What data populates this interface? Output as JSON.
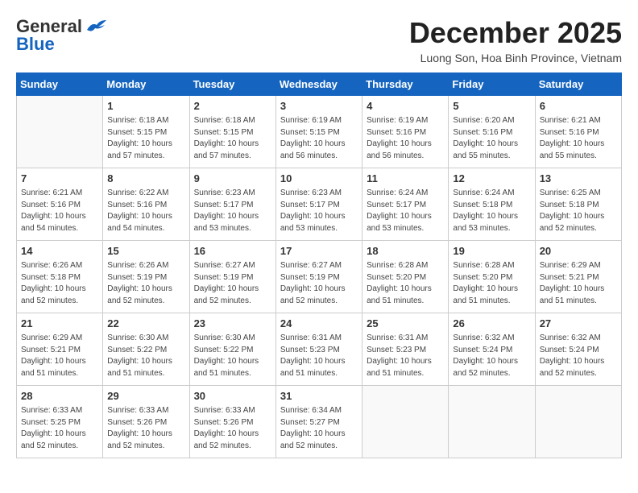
{
  "header": {
    "logo_line1": "General",
    "logo_line2": "Blue",
    "month_title": "December 2025",
    "subtitle": "Luong Son, Hoa Binh Province, Vietnam"
  },
  "weekdays": [
    "Sunday",
    "Monday",
    "Tuesday",
    "Wednesday",
    "Thursday",
    "Friday",
    "Saturday"
  ],
  "weeks": [
    [
      {
        "day": "",
        "info": ""
      },
      {
        "day": "1",
        "info": "Sunrise: 6:18 AM\nSunset: 5:15 PM\nDaylight: 10 hours\nand 57 minutes."
      },
      {
        "day": "2",
        "info": "Sunrise: 6:18 AM\nSunset: 5:15 PM\nDaylight: 10 hours\nand 57 minutes."
      },
      {
        "day": "3",
        "info": "Sunrise: 6:19 AM\nSunset: 5:15 PM\nDaylight: 10 hours\nand 56 minutes."
      },
      {
        "day": "4",
        "info": "Sunrise: 6:19 AM\nSunset: 5:16 PM\nDaylight: 10 hours\nand 56 minutes."
      },
      {
        "day": "5",
        "info": "Sunrise: 6:20 AM\nSunset: 5:16 PM\nDaylight: 10 hours\nand 55 minutes."
      },
      {
        "day": "6",
        "info": "Sunrise: 6:21 AM\nSunset: 5:16 PM\nDaylight: 10 hours\nand 55 minutes."
      }
    ],
    [
      {
        "day": "7",
        "info": "Sunrise: 6:21 AM\nSunset: 5:16 PM\nDaylight: 10 hours\nand 54 minutes."
      },
      {
        "day": "8",
        "info": "Sunrise: 6:22 AM\nSunset: 5:16 PM\nDaylight: 10 hours\nand 54 minutes."
      },
      {
        "day": "9",
        "info": "Sunrise: 6:23 AM\nSunset: 5:17 PM\nDaylight: 10 hours\nand 53 minutes."
      },
      {
        "day": "10",
        "info": "Sunrise: 6:23 AM\nSunset: 5:17 PM\nDaylight: 10 hours\nand 53 minutes."
      },
      {
        "day": "11",
        "info": "Sunrise: 6:24 AM\nSunset: 5:17 PM\nDaylight: 10 hours\nand 53 minutes."
      },
      {
        "day": "12",
        "info": "Sunrise: 6:24 AM\nSunset: 5:18 PM\nDaylight: 10 hours\nand 53 minutes."
      },
      {
        "day": "13",
        "info": "Sunrise: 6:25 AM\nSunset: 5:18 PM\nDaylight: 10 hours\nand 52 minutes."
      }
    ],
    [
      {
        "day": "14",
        "info": "Sunrise: 6:26 AM\nSunset: 5:18 PM\nDaylight: 10 hours\nand 52 minutes."
      },
      {
        "day": "15",
        "info": "Sunrise: 6:26 AM\nSunset: 5:19 PM\nDaylight: 10 hours\nand 52 minutes."
      },
      {
        "day": "16",
        "info": "Sunrise: 6:27 AM\nSunset: 5:19 PM\nDaylight: 10 hours\nand 52 minutes."
      },
      {
        "day": "17",
        "info": "Sunrise: 6:27 AM\nSunset: 5:19 PM\nDaylight: 10 hours\nand 52 minutes."
      },
      {
        "day": "18",
        "info": "Sunrise: 6:28 AM\nSunset: 5:20 PM\nDaylight: 10 hours\nand 51 minutes."
      },
      {
        "day": "19",
        "info": "Sunrise: 6:28 AM\nSunset: 5:20 PM\nDaylight: 10 hours\nand 51 minutes."
      },
      {
        "day": "20",
        "info": "Sunrise: 6:29 AM\nSunset: 5:21 PM\nDaylight: 10 hours\nand 51 minutes."
      }
    ],
    [
      {
        "day": "21",
        "info": "Sunrise: 6:29 AM\nSunset: 5:21 PM\nDaylight: 10 hours\nand 51 minutes."
      },
      {
        "day": "22",
        "info": "Sunrise: 6:30 AM\nSunset: 5:22 PM\nDaylight: 10 hours\nand 51 minutes."
      },
      {
        "day": "23",
        "info": "Sunrise: 6:30 AM\nSunset: 5:22 PM\nDaylight: 10 hours\nand 51 minutes."
      },
      {
        "day": "24",
        "info": "Sunrise: 6:31 AM\nSunset: 5:23 PM\nDaylight: 10 hours\nand 51 minutes."
      },
      {
        "day": "25",
        "info": "Sunrise: 6:31 AM\nSunset: 5:23 PM\nDaylight: 10 hours\nand 51 minutes."
      },
      {
        "day": "26",
        "info": "Sunrise: 6:32 AM\nSunset: 5:24 PM\nDaylight: 10 hours\nand 52 minutes."
      },
      {
        "day": "27",
        "info": "Sunrise: 6:32 AM\nSunset: 5:24 PM\nDaylight: 10 hours\nand 52 minutes."
      }
    ],
    [
      {
        "day": "28",
        "info": "Sunrise: 6:33 AM\nSunset: 5:25 PM\nDaylight: 10 hours\nand 52 minutes."
      },
      {
        "day": "29",
        "info": "Sunrise: 6:33 AM\nSunset: 5:26 PM\nDaylight: 10 hours\nand 52 minutes."
      },
      {
        "day": "30",
        "info": "Sunrise: 6:33 AM\nSunset: 5:26 PM\nDaylight: 10 hours\nand 52 minutes."
      },
      {
        "day": "31",
        "info": "Sunrise: 6:34 AM\nSunset: 5:27 PM\nDaylight: 10 hours\nand 52 minutes."
      },
      {
        "day": "",
        "info": ""
      },
      {
        "day": "",
        "info": ""
      },
      {
        "day": "",
        "info": ""
      }
    ]
  ]
}
